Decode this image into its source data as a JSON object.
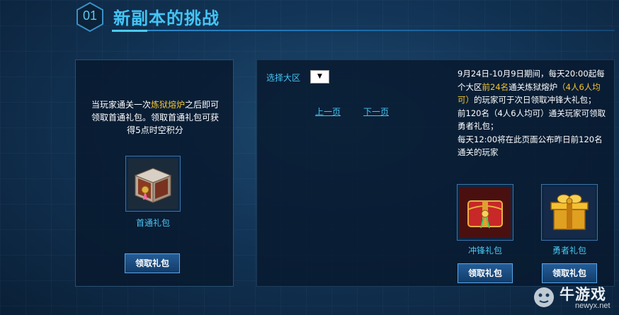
{
  "header": {
    "section_number": "01",
    "title": "新副本的挑战"
  },
  "left_panel": {
    "desc_part1": "当玩家通关一次",
    "desc_highlight": "炼狱熔炉",
    "desc_part2": "之后即可领取首通礼包。领取首通礼包可获得5点时空积分",
    "gift_name": "首通礼包",
    "claim_label": "领取礼包"
  },
  "right_panel": {
    "region_label": "选择大区",
    "region_select_value": "",
    "prev_page": "上一页",
    "next_page": "下一页",
    "rules": {
      "line1_a": "9月24日-10月9日期间，每天20:00起每个大区",
      "line1_hl1": "前24名",
      "line1_b": "通关炼狱熔炉",
      "line1_hl2": "（4人6人均可）",
      "line1_c": "的玩家可于次日领取冲锋大礼包；",
      "line2": "前120名（4人6人均可）通关玩家可领取勇者礼包；",
      "line3": "每天12:00将在此页面公布昨日前120名通关的玩家"
    },
    "gifts": [
      {
        "name": "冲锋礼包",
        "claim_label": "领取礼包"
      },
      {
        "name": "勇者礼包",
        "claim_label": "领取礼包"
      }
    ]
  },
  "watermark": {
    "brand": "牛游戏",
    "url": "newyx.net"
  },
  "colors": {
    "accent_blue": "#44c4f4",
    "highlight_gold": "#f5c431",
    "background": "#123456"
  }
}
